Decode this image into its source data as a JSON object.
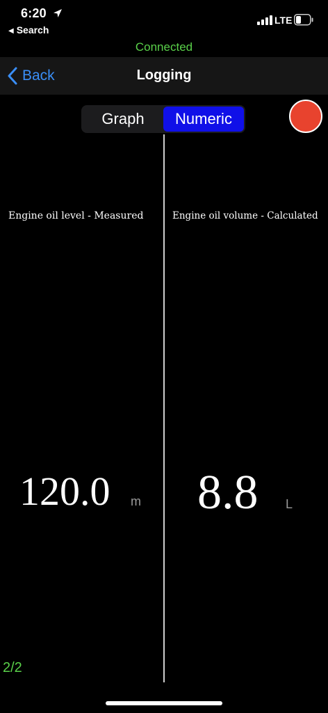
{
  "status_bar": {
    "time": "6:20",
    "back_app": "Search",
    "network": "LTE"
  },
  "connection_status": "Connected",
  "nav": {
    "back_label": "Back",
    "title": "Logging"
  },
  "view_toggle": {
    "options": [
      "Graph",
      "Numeric"
    ],
    "selected": "Numeric"
  },
  "panels": [
    {
      "label": "Engine oil level  -  Measured",
      "value": "120.0",
      "unit": "m"
    },
    {
      "label": "Engine oil volume  -  Calculated",
      "value": "8.8",
      "unit": "L"
    }
  ],
  "page_indicator": "2/2",
  "colors": {
    "connected": "#5ad14a",
    "accent_blue": "#3a8ef6",
    "selected_segment": "#1010e8",
    "record": "#e8432e"
  },
  "icons": {
    "location": "location-arrow-icon",
    "signal": "cellular-signal-icon",
    "battery": "battery-icon",
    "back": "chevron-left-icon",
    "record": "record-icon"
  }
}
